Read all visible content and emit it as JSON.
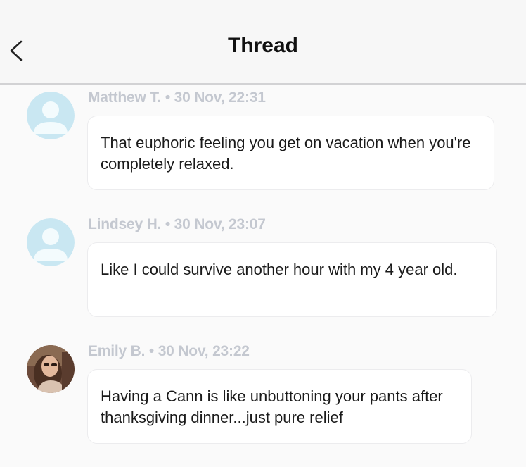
{
  "header": {
    "title": "Thread",
    "back_icon": "chevron-left-icon"
  },
  "messages": [
    {
      "author": "Matthew T.",
      "separator": "•",
      "timestamp": "30 Nov, 22:31",
      "text": "That euphoric feeling you get on vacation when you're completely relaxed.",
      "avatar": "default-person-icon"
    },
    {
      "author": "Lindsey H.",
      "separator": "•",
      "timestamp": "30 Nov, 23:07",
      "text": "Like I could survive another hour with my 4 year old.",
      "avatar": "default-person-icon"
    },
    {
      "author": "Emily B.",
      "separator": "•",
      "timestamp": "30 Nov, 23:22",
      "text": "Having a Cann is like unbuttoning your pants after thanksgiving dinner...just pure relief",
      "avatar": "profile-photo"
    }
  ],
  "colors": {
    "avatar_bg": "#c9e7f2",
    "avatar_fg": "#f3fbfd",
    "meta_text": "#c4c8d0"
  }
}
